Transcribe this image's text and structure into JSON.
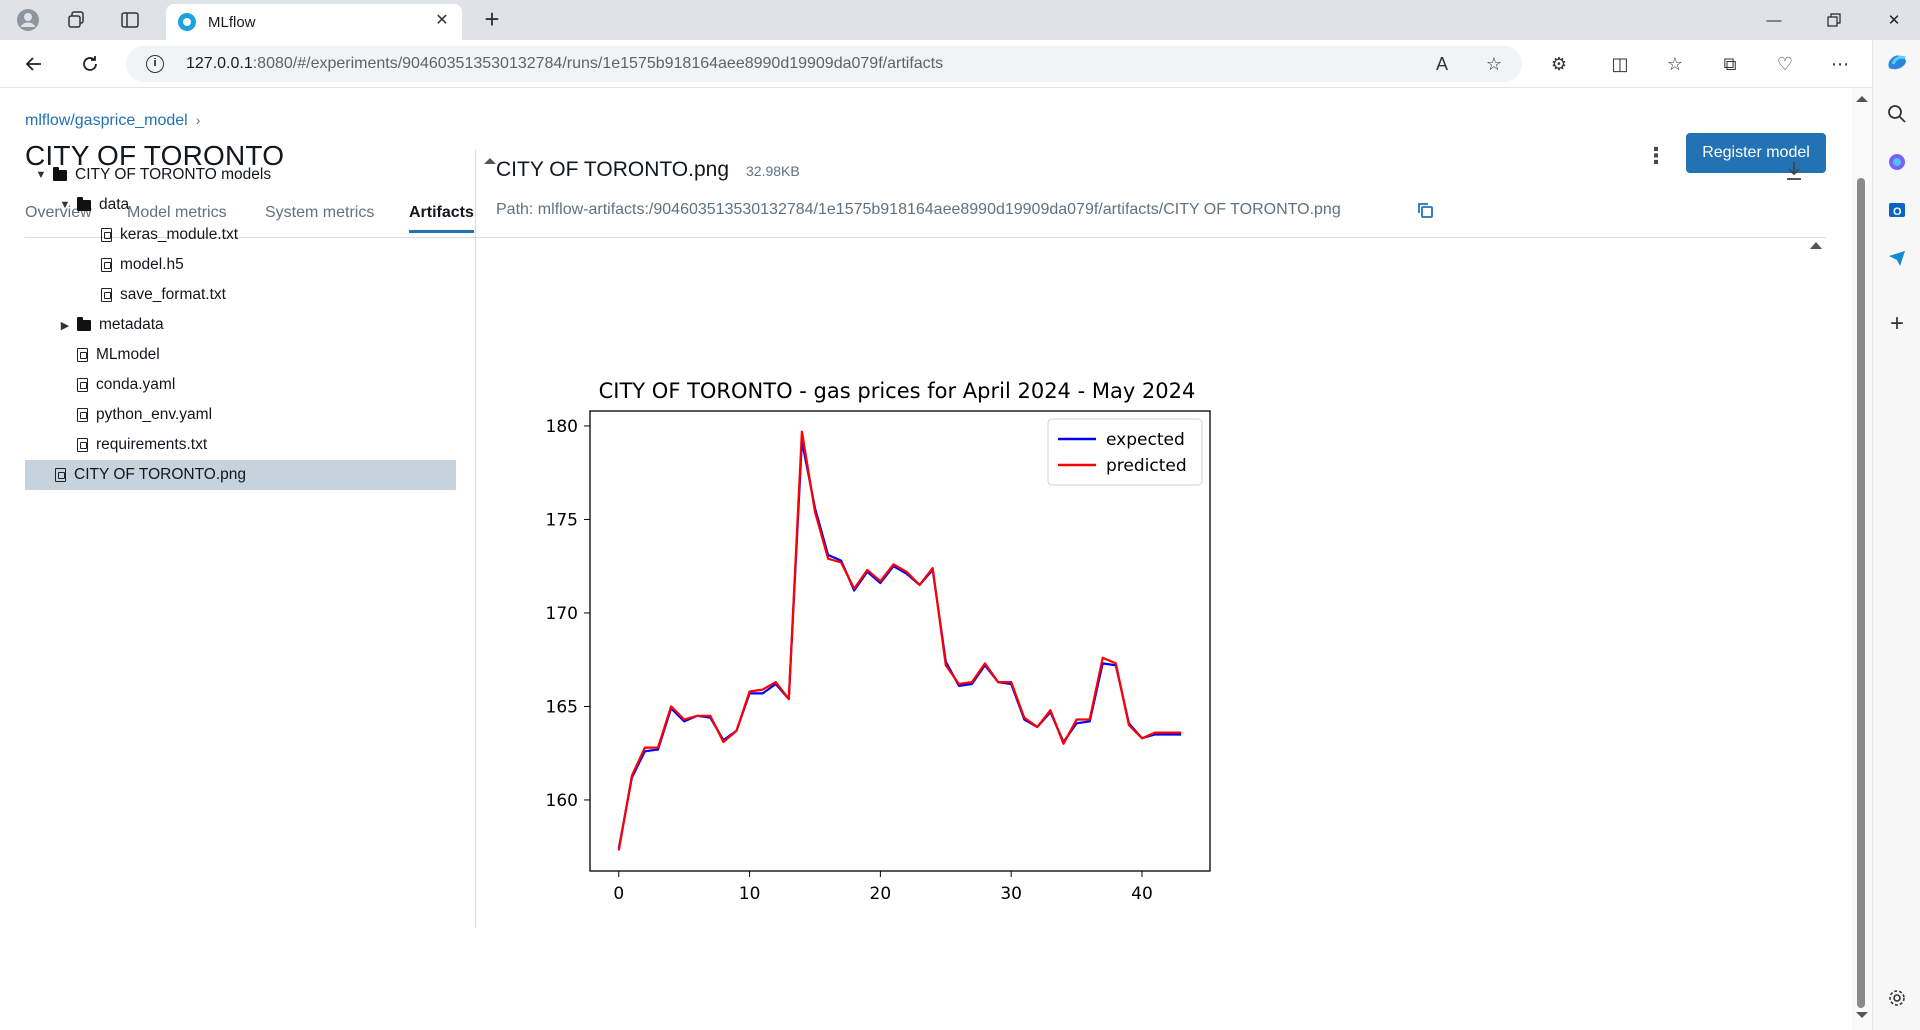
{
  "browser": {
    "tab_title": "MLflow",
    "url_host": "127.0.0.1",
    "url_rest": ":8080/#/experiments/904603513530132784/runs/1e1575b918164aee8990d19909da079f/artifacts"
  },
  "page": {
    "breadcrumb": "mlflow/gasprice_model",
    "title": "CITY OF TORONTO",
    "register_label": "Register model",
    "tabs": [
      "Overview",
      "Model metrics",
      "System metrics",
      "Artifacts"
    ]
  },
  "tree": {
    "root": "CITY OF TORONTO models",
    "data_folder": "data",
    "data_files": [
      "keras_module.txt",
      "model.h5",
      "save_format.txt"
    ],
    "metadata_folder": "metadata",
    "root_files": [
      "MLmodel",
      "conda.yaml",
      "python_env.yaml",
      "requirements.txt"
    ],
    "selected": "CITY OF TORONTO.png"
  },
  "artifact": {
    "name": "CITY OF TORONTO.png",
    "size": "32.98KB",
    "path": "Path: mlflow-artifacts:/904603513530132784/1e1575b918164aee8990d19909da079f/artifacts/CITY OF TORONTO.png"
  },
  "chart_data": {
    "type": "line",
    "title": "CITY OF TORONTO - gas prices for April 2024 - May 2024",
    "xlabel": "",
    "ylabel": "",
    "xlim": [
      -2.2,
      45.2
    ],
    "ylim": [
      156.2,
      180.8
    ],
    "xticks": [
      0,
      10,
      20,
      30,
      40
    ],
    "yticks": [
      160,
      165,
      170,
      175,
      180
    ],
    "legend": "top-right",
    "grid": false,
    "series": [
      {
        "name": "expected",
        "color": "#0000ff",
        "x": [
          0,
          1,
          2,
          3,
          4,
          5,
          6,
          7,
          8,
          9,
          10,
          11,
          12,
          13,
          14,
          15,
          16,
          17,
          18,
          19,
          20,
          21,
          22,
          23,
          24,
          25,
          26,
          27,
          28,
          29,
          30,
          31,
          32,
          33,
          34,
          35,
          36,
          37,
          38,
          39,
          40,
          41,
          42,
          43
        ],
        "y": [
          157.4,
          161.2,
          162.6,
          162.7,
          164.9,
          164.2,
          164.5,
          164.4,
          163.2,
          163.7,
          165.7,
          165.7,
          166.2,
          165.4,
          179.2,
          175.6,
          173.1,
          172.8,
          171.2,
          172.2,
          171.6,
          172.5,
          172.1,
          171.5,
          172.3,
          167.4,
          166.1,
          166.2,
          167.2,
          166.3,
          166.2,
          164.3,
          163.9,
          164.7,
          163.1,
          164.1,
          164.2,
          167.3,
          167.2,
          164.1,
          163.3,
          163.5,
          163.5,
          163.5
        ]
      },
      {
        "name": "predicted",
        "color": "#ff0000",
        "x": [
          0,
          1,
          2,
          3,
          4,
          5,
          6,
          7,
          8,
          9,
          10,
          11,
          12,
          13,
          14,
          15,
          16,
          17,
          18,
          19,
          20,
          21,
          22,
          23,
          24,
          25,
          26,
          27,
          28,
          29,
          30,
          31,
          32,
          33,
          34,
          35,
          36,
          37,
          38,
          39,
          40,
          41,
          42,
          43
        ],
        "y": [
          157.3,
          161.3,
          162.8,
          162.8,
          165.0,
          164.3,
          164.5,
          164.5,
          163.1,
          163.7,
          165.8,
          165.9,
          166.3,
          165.4,
          179.7,
          175.4,
          172.9,
          172.7,
          171.3,
          172.3,
          171.7,
          172.6,
          172.2,
          171.5,
          172.4,
          167.2,
          166.2,
          166.3,
          167.3,
          166.3,
          166.3,
          164.4,
          163.9,
          164.8,
          163.0,
          164.3,
          164.3,
          167.6,
          167.3,
          164.0,
          163.3,
          163.6,
          163.6,
          163.6
        ]
      }
    ]
  }
}
